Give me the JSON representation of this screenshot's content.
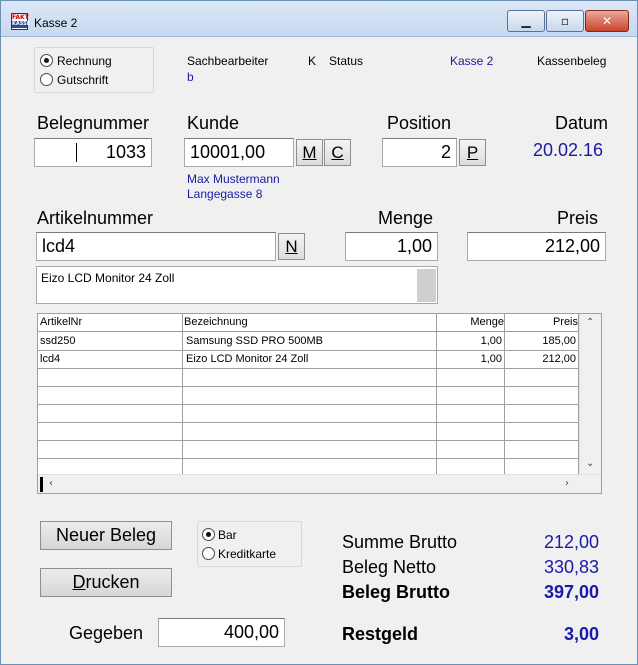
{
  "window": {
    "title": "Kasse 2"
  },
  "doc_type": {
    "rechnung": "Rechnung",
    "gutschrift": "Gutschrift",
    "selected": "Rechnung"
  },
  "info": {
    "sachbearbeiter_label": "Sachbearbeiter",
    "sachbearbeiter_value": "b",
    "k_label": "K",
    "status_label": "Status",
    "kasse_value": "Kasse 2",
    "kassenbeleg_label": "Kassenbeleg"
  },
  "beleg": {
    "label": "Belegnummer",
    "value": "1033"
  },
  "kunde": {
    "label": "Kunde",
    "value": "10001,00",
    "btn_m": "M",
    "btn_c": "C",
    "name": "Max Mustermann",
    "street": "Langegasse 8"
  },
  "position": {
    "label": "Position",
    "value": "2",
    "btn_p": "P"
  },
  "datum": {
    "label": "Datum",
    "value": "20.02.16"
  },
  "artikel": {
    "label": "Artikelnummer",
    "value": "lcd4",
    "btn_n": "N",
    "description": "Eizo LCD Monitor 24 Zoll"
  },
  "menge": {
    "label": "Menge",
    "value": "1,00"
  },
  "preis": {
    "label": "Preis",
    "value": "212,00"
  },
  "table": {
    "columns": [
      "ArtikelNr",
      "Bezeichnung",
      "Menge",
      "Preis"
    ],
    "rows": [
      [
        "ssd250",
        "Samsung SSD PRO 500MB",
        "1,00",
        "185,00"
      ],
      [
        "lcd4",
        "Eizo LCD Monitor 24 Zoll",
        "1,00",
        "212,00"
      ]
    ]
  },
  "buttons": {
    "neuer_beleg": "Neuer Beleg",
    "drucken": "Drucken"
  },
  "payment": {
    "bar": "Bar",
    "kreditkarte": "Kreditkarte",
    "selected": "Bar"
  },
  "gegeben": {
    "label": "Gegeben",
    "value": "400,00"
  },
  "totals": {
    "summe_brutto_label": "Summe Brutto",
    "summe_brutto": "212,00",
    "beleg_netto_label": "Beleg Netto",
    "beleg_netto": "330,83",
    "beleg_brutto_label": "Beleg Brutto",
    "beleg_brutto": "397,00",
    "restgeld_label": "Restgeld",
    "restgeld": "3,00"
  },
  "colors": {
    "accent_blue": "#1a1aa6"
  }
}
